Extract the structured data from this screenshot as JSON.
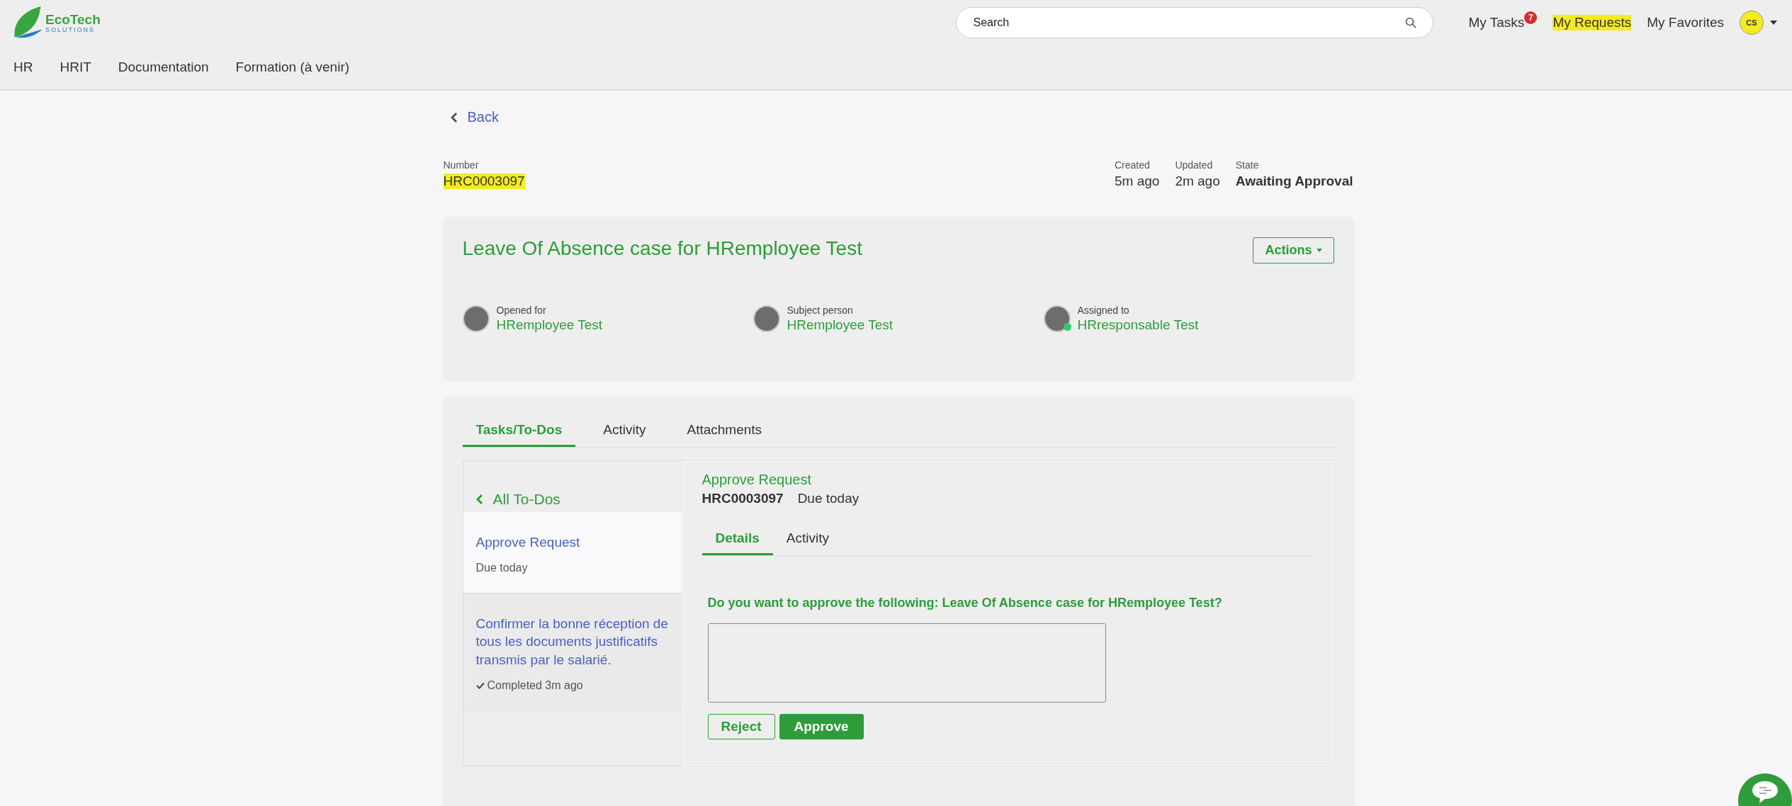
{
  "header": {
    "logo": {
      "name": "EcoTech",
      "tagline": "SOLUTIONS"
    },
    "search": {
      "placeholder": "Search"
    },
    "links": [
      {
        "label": "My Tasks",
        "badge": "7",
        "highlighted": false
      },
      {
        "label": "My Requests",
        "highlighted": true
      },
      {
        "label": "My Favorites",
        "highlighted": false
      }
    ],
    "user": {
      "initials": "CS",
      "highlighted": true
    }
  },
  "nav": [
    "HR",
    "HRIT",
    "Documentation",
    "Formation (à venir)"
  ],
  "back": "Back",
  "record": {
    "number_label": "Number",
    "number": "HRC0003097",
    "number_highlighted": true,
    "meta": [
      {
        "label": "Created",
        "value": "5m ago",
        "kind": "plain"
      },
      {
        "label": "Updated",
        "value": "2m ago",
        "kind": "plain"
      },
      {
        "label": "State",
        "value": "Awaiting Approval",
        "kind": "bold"
      }
    ]
  },
  "case": {
    "title": "Leave Of Absence case for HRemployee Test",
    "actions": "Actions",
    "people": [
      {
        "label": "Opened for",
        "name": "HRemployee Test",
        "online": false
      },
      {
        "label": "Subject person",
        "name": "HRemployee Test",
        "online": false
      },
      {
        "label": "Assigned to",
        "name": "HRresponsable Test",
        "online": true
      }
    ]
  },
  "tabs": [
    {
      "label": "Tasks/To-Dos",
      "selected": true
    },
    {
      "label": "Activity",
      "selected": false
    },
    {
      "label": "Attachments",
      "selected": false
    }
  ],
  "todos": {
    "back": "All To-Dos",
    "items": [
      {
        "title": "Approve Request",
        "status": "Due today",
        "completed": false,
        "selected": true
      },
      {
        "title": "Confirmer la bonne réception de tous les documents justificatifs transmis par le salarié.",
        "status": "Completed 3m ago",
        "completed": true,
        "selected": false
      }
    ]
  },
  "task": {
    "title": "Approve Request",
    "number": "HRC0003097",
    "due": "Due today",
    "tabs": [
      {
        "label": "Details",
        "selected": true
      },
      {
        "label": "Activity",
        "selected": false
      }
    ],
    "question": "Do you want to approve the following: Leave Of Absence case for HRemployee Test?",
    "buttons": [
      {
        "label": "Reject",
        "kind": "secondary"
      },
      {
        "label": "Approve",
        "kind": "primary"
      }
    ]
  }
}
